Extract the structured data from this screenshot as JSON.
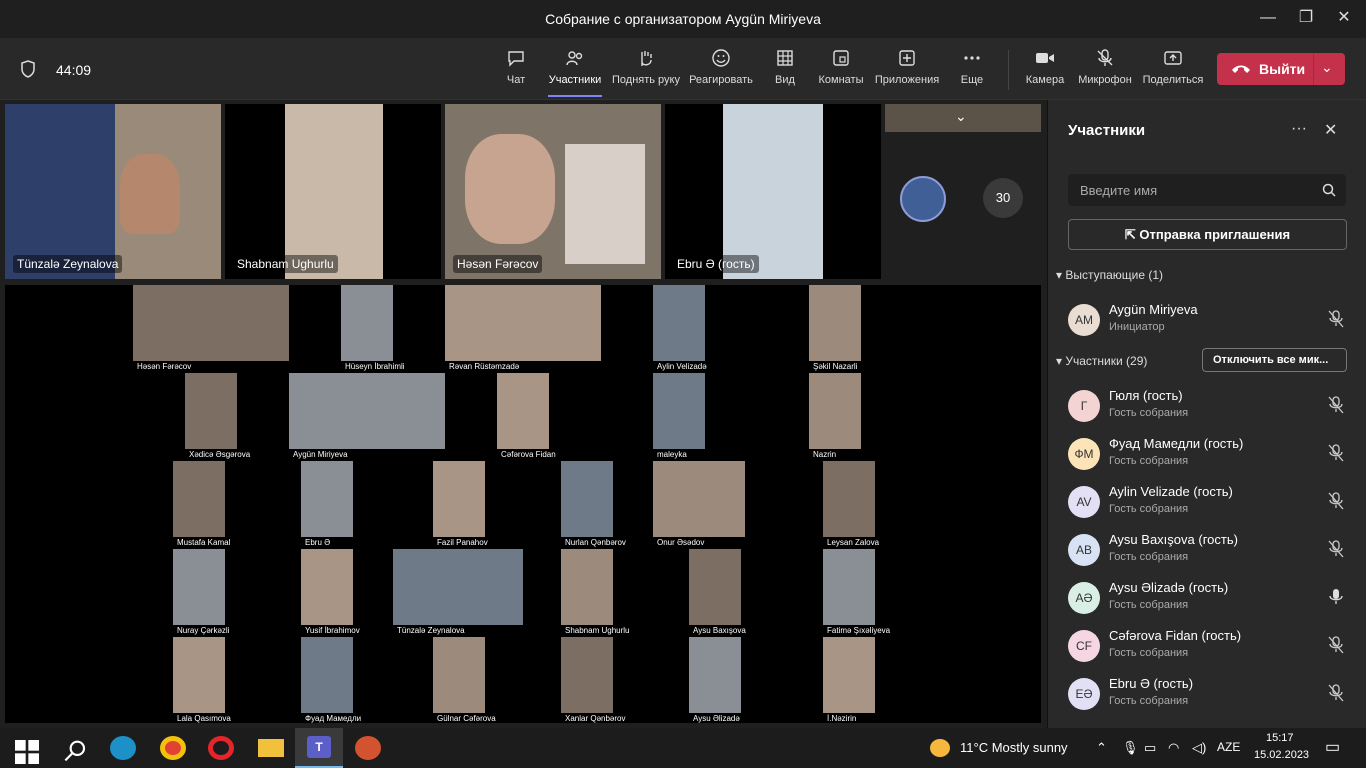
{
  "window": {
    "title": "Собрание с организатором Aygün Miriyeva"
  },
  "toolbar": {
    "timer": "44:09",
    "buttons": [
      {
        "label": "Чат"
      },
      {
        "label": "Участники"
      },
      {
        "label": "Поднять руку"
      },
      {
        "label": "Реагировать"
      },
      {
        "label": "Вид"
      },
      {
        "label": "Комнаты"
      },
      {
        "label": "Приложения"
      },
      {
        "label": "Еще"
      },
      {
        "label": "Камера"
      },
      {
        "label": "Микрофон"
      },
      {
        "label": "Поделиться"
      }
    ],
    "leave_label": "Выйти"
  },
  "stage": {
    "top_tiles": [
      {
        "name": "Tünzalə Zeynalova"
      },
      {
        "name": "Shabnam Ughurlu"
      },
      {
        "name": "Həsən Fərəcov"
      },
      {
        "name": "Ebru Ə (гость)"
      }
    ],
    "overflow_count": "30",
    "gallery": [
      "Həsən Fərəcov",
      "Hüseyn İbrahimli",
      "Rəvan Rüstəmzadə",
      "Aylin Velizadə",
      "Şəkil Nazarli",
      "Xədicə Əsgərova",
      "Aygün Miriyeva",
      "Cəfərova Fidan",
      "maleyka",
      "Nazrin",
      "Mustafa Kamal",
      "Ebru Ə",
      "Fazil Panahov",
      "Nurlan Qənbərov",
      "Onur Əsədov",
      "Leysan Zalova",
      "Nuray Çərkəzli",
      "Yusif İbrahimov",
      "Tünzalə Zeynalova",
      "Shabnam Ughurlu",
      "Aysu Baxışova",
      "Fatimə Şıxəliyeva",
      "Lala Qasımova",
      "Фуад Мамедли",
      "Gülnar Cəfərova",
      "Xanlar Qənbərov",
      "Aysu Əlizadə",
      "İ.Nəzirin"
    ]
  },
  "panel": {
    "title": "Участники",
    "search_placeholder": "Введите имя",
    "invite_label": "Отправка приглашения",
    "presenters_label": "Выступающие (1)",
    "attendees_label": "Участники (29)",
    "mute_all_label": "Отключить все мик...",
    "presenter": {
      "initials": "AM",
      "name": "Aygün Miriyeva",
      "role": "Инициатор"
    },
    "people": [
      {
        "initials": "Г",
        "name": "Гюля (гость)",
        "role": "Гость собрания",
        "color": "#f4d3d3"
      },
      {
        "initials": "ФМ",
        "name": "Фуад Мамедли (гость)",
        "role": "Гость собрания",
        "color": "#fce4b8"
      },
      {
        "initials": "AV",
        "name": "Aylin Velizade (гость)",
        "role": "Гость собрания",
        "color": "#e3dff5"
      },
      {
        "initials": "AB",
        "name": "Aysu Baxışova (гость)",
        "role": "Гость собрания",
        "color": "#d7e3f5"
      },
      {
        "initials": "AƏ",
        "name": "Aysu Əlizadə (гость)",
        "role": "Гость собрания",
        "color": "#d9efe6"
      },
      {
        "initials": "CF",
        "name": "Cəfərova Fidan (гость)",
        "role": "Гость собрания",
        "color": "#f6d6e3"
      },
      {
        "initials": "EƏ",
        "name": "Ebru Ə (гость)",
        "role": "Гость собрания",
        "color": "#e2e0f4"
      }
    ]
  },
  "taskbar": {
    "weather": "11°C  Mostly sunny",
    "lang": "AZE",
    "time": "15:17",
    "date": "15.02.2023"
  }
}
